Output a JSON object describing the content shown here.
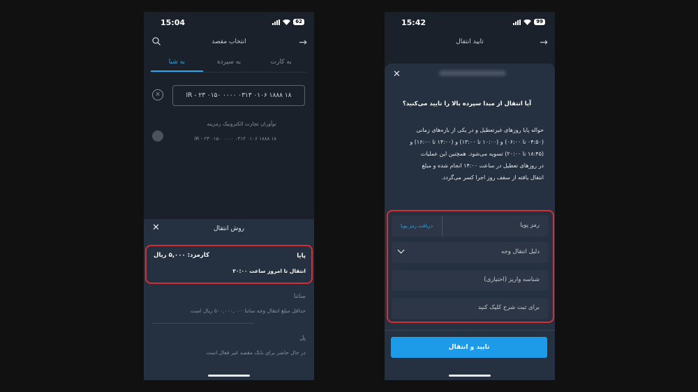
{
  "left_screen": {
    "status": {
      "time": "15:04",
      "battery": "62"
    },
    "title": "انتخاب مقصد",
    "tabs": [
      {
        "label": "به کارت"
      },
      {
        "label": "به سپرده"
      },
      {
        "label": "به شبا"
      }
    ],
    "iban_value": "IR - ۲۳ ۰۱۵۰ ۰۰۰۰ ۰۳۱۳ ۰۱۰۶ ۱۸۸۸ ۱۸",
    "owner": {
      "name": "نوآوران تجارت الکترونیک رمزینه",
      "iban": "IR - ۲۳ ۰۱۵۰ ۰۰۰۰ ۰۳۱۳ ۰۱۰۶ ۱۸۸۸ ۱۸"
    },
    "sheet": {
      "title": "روش انتقال",
      "methods": [
        {
          "name": "پایا",
          "fee": "کارمزد: ۵,۰۰۰ ریال",
          "desc": "انتقال تا امروز ساعت ۲۰:۰۰"
        },
        {
          "name": "ساتنا",
          "desc": "حداقل مبلغ انتقال وجه ساتنا ۵۰۰,۰۰۰,۰۰۰ ریال است"
        },
        {
          "name": "پل",
          "desc": "در حال حاضر برای بانک مقصد غیر فعال است"
        }
      ]
    }
  },
  "right_screen": {
    "status": {
      "time": "15:42",
      "battery": "99"
    },
    "title": "تایید انتقال",
    "question": "آیا انتقال از مبدا سپرده بالا را تایید می‌کنید؟",
    "body_lines": [
      "حواله پایا روزهای غیرتعطیل و در یکی از بازه‌های زمانی",
      "(۰۴:۵۰ تا ۰۶:۰۰) و (۱۰:۰۰ تا ۱۳:۰۰) و (۱۴:۰۰ تا ۱۶:۰۰) و",
      "(۱۸:۴۵ تا ۲۰:۰۰) تسویه می‌شود. همچنین این عملیات",
      "در روزهای تعطیل در ساعت ۱۴:۰۰ انجام شده و مبلغ",
      "انتقال یافته از سقف روز اجرا کسر می‌گردد."
    ],
    "fields": {
      "otp_label": "رمز پویا",
      "otp_button": "دریافت رمز پویا",
      "reason_label": "دلیل انتقال وجه",
      "deposit_id_label": "شناسه واریز (اختیاری)",
      "description_label": "برای ثبت شرح کلیک کنید"
    },
    "confirm_button": "تایید و انتقال"
  },
  "colors": {
    "accent": "#2aa7e8",
    "highlight": "#d92d34",
    "button": "#1d9be8"
  }
}
